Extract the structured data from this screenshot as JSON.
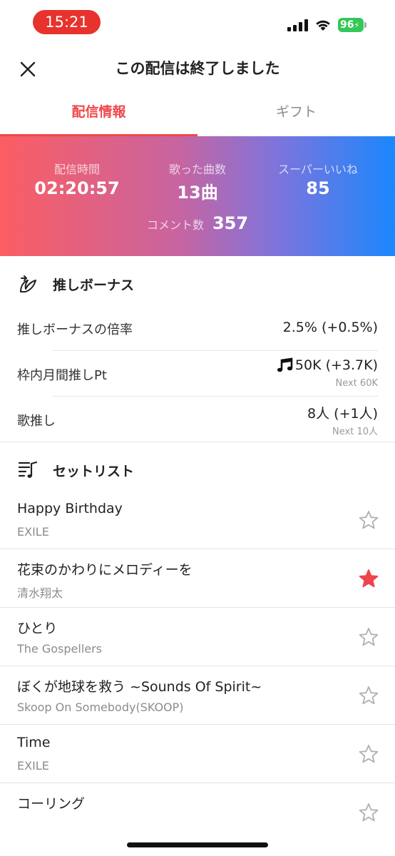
{
  "status_bar": {
    "time": "15:21",
    "battery": "96",
    "colors": {
      "time_pill": "#e8322e",
      "battery": "#34c759"
    }
  },
  "header": {
    "title": "この配信は終了しました",
    "close_icon": "close-icon"
  },
  "tabs": [
    {
      "label": "配信情報",
      "active": true
    },
    {
      "label": "ギフト",
      "active": false
    }
  ],
  "stats": {
    "duration": {
      "label": "配信時間",
      "value": "02:20:57"
    },
    "songs": {
      "label": "歌った曲数",
      "value": "13曲"
    },
    "super_likes": {
      "label": "スーパーいいね",
      "value": "85"
    },
    "comments": {
      "label": "コメント数",
      "value": "357"
    }
  },
  "bonus": {
    "title": "推しボーナス",
    "icon": "wing-icon",
    "rows": [
      {
        "label": "推しボーナスの倍率",
        "value": "2.5% (+0.5%)",
        "next": ""
      },
      {
        "label": "枠内月間推しPt",
        "value": "50K (+3.7K)",
        "next": "Next 60K",
        "icon": "music-note-icon"
      },
      {
        "label": "歌推し",
        "value": "8人 (+1人)",
        "next": "Next 10人"
      }
    ]
  },
  "setlist": {
    "title": "セットリスト",
    "icon": "playlist-icon",
    "songs": [
      {
        "title": "Happy Birthday",
        "artist": "EXILE",
        "favorited": false
      },
      {
        "title": "花束のかわりにメロディーを",
        "artist": "清水翔太",
        "favorited": true
      },
      {
        "title": "ひとり",
        "artist": "The Gospellers",
        "favorited": false
      },
      {
        "title": "ぼくが地球を救う ~Sounds Of Spirit~",
        "artist": "Skoop On Somebody(SKOOP)",
        "favorited": false
      },
      {
        "title": "Time",
        "artist": "EXILE",
        "favorited": false
      },
      {
        "title": "コーリング",
        "artist": "",
        "favorited": false
      }
    ]
  },
  "colors": {
    "accent": "#f0484a",
    "gradient_start": "#fb5e62",
    "gradient_end": "#1b87fd",
    "star_active": "#ef4450",
    "star_inactive": "#b0b0b0"
  }
}
